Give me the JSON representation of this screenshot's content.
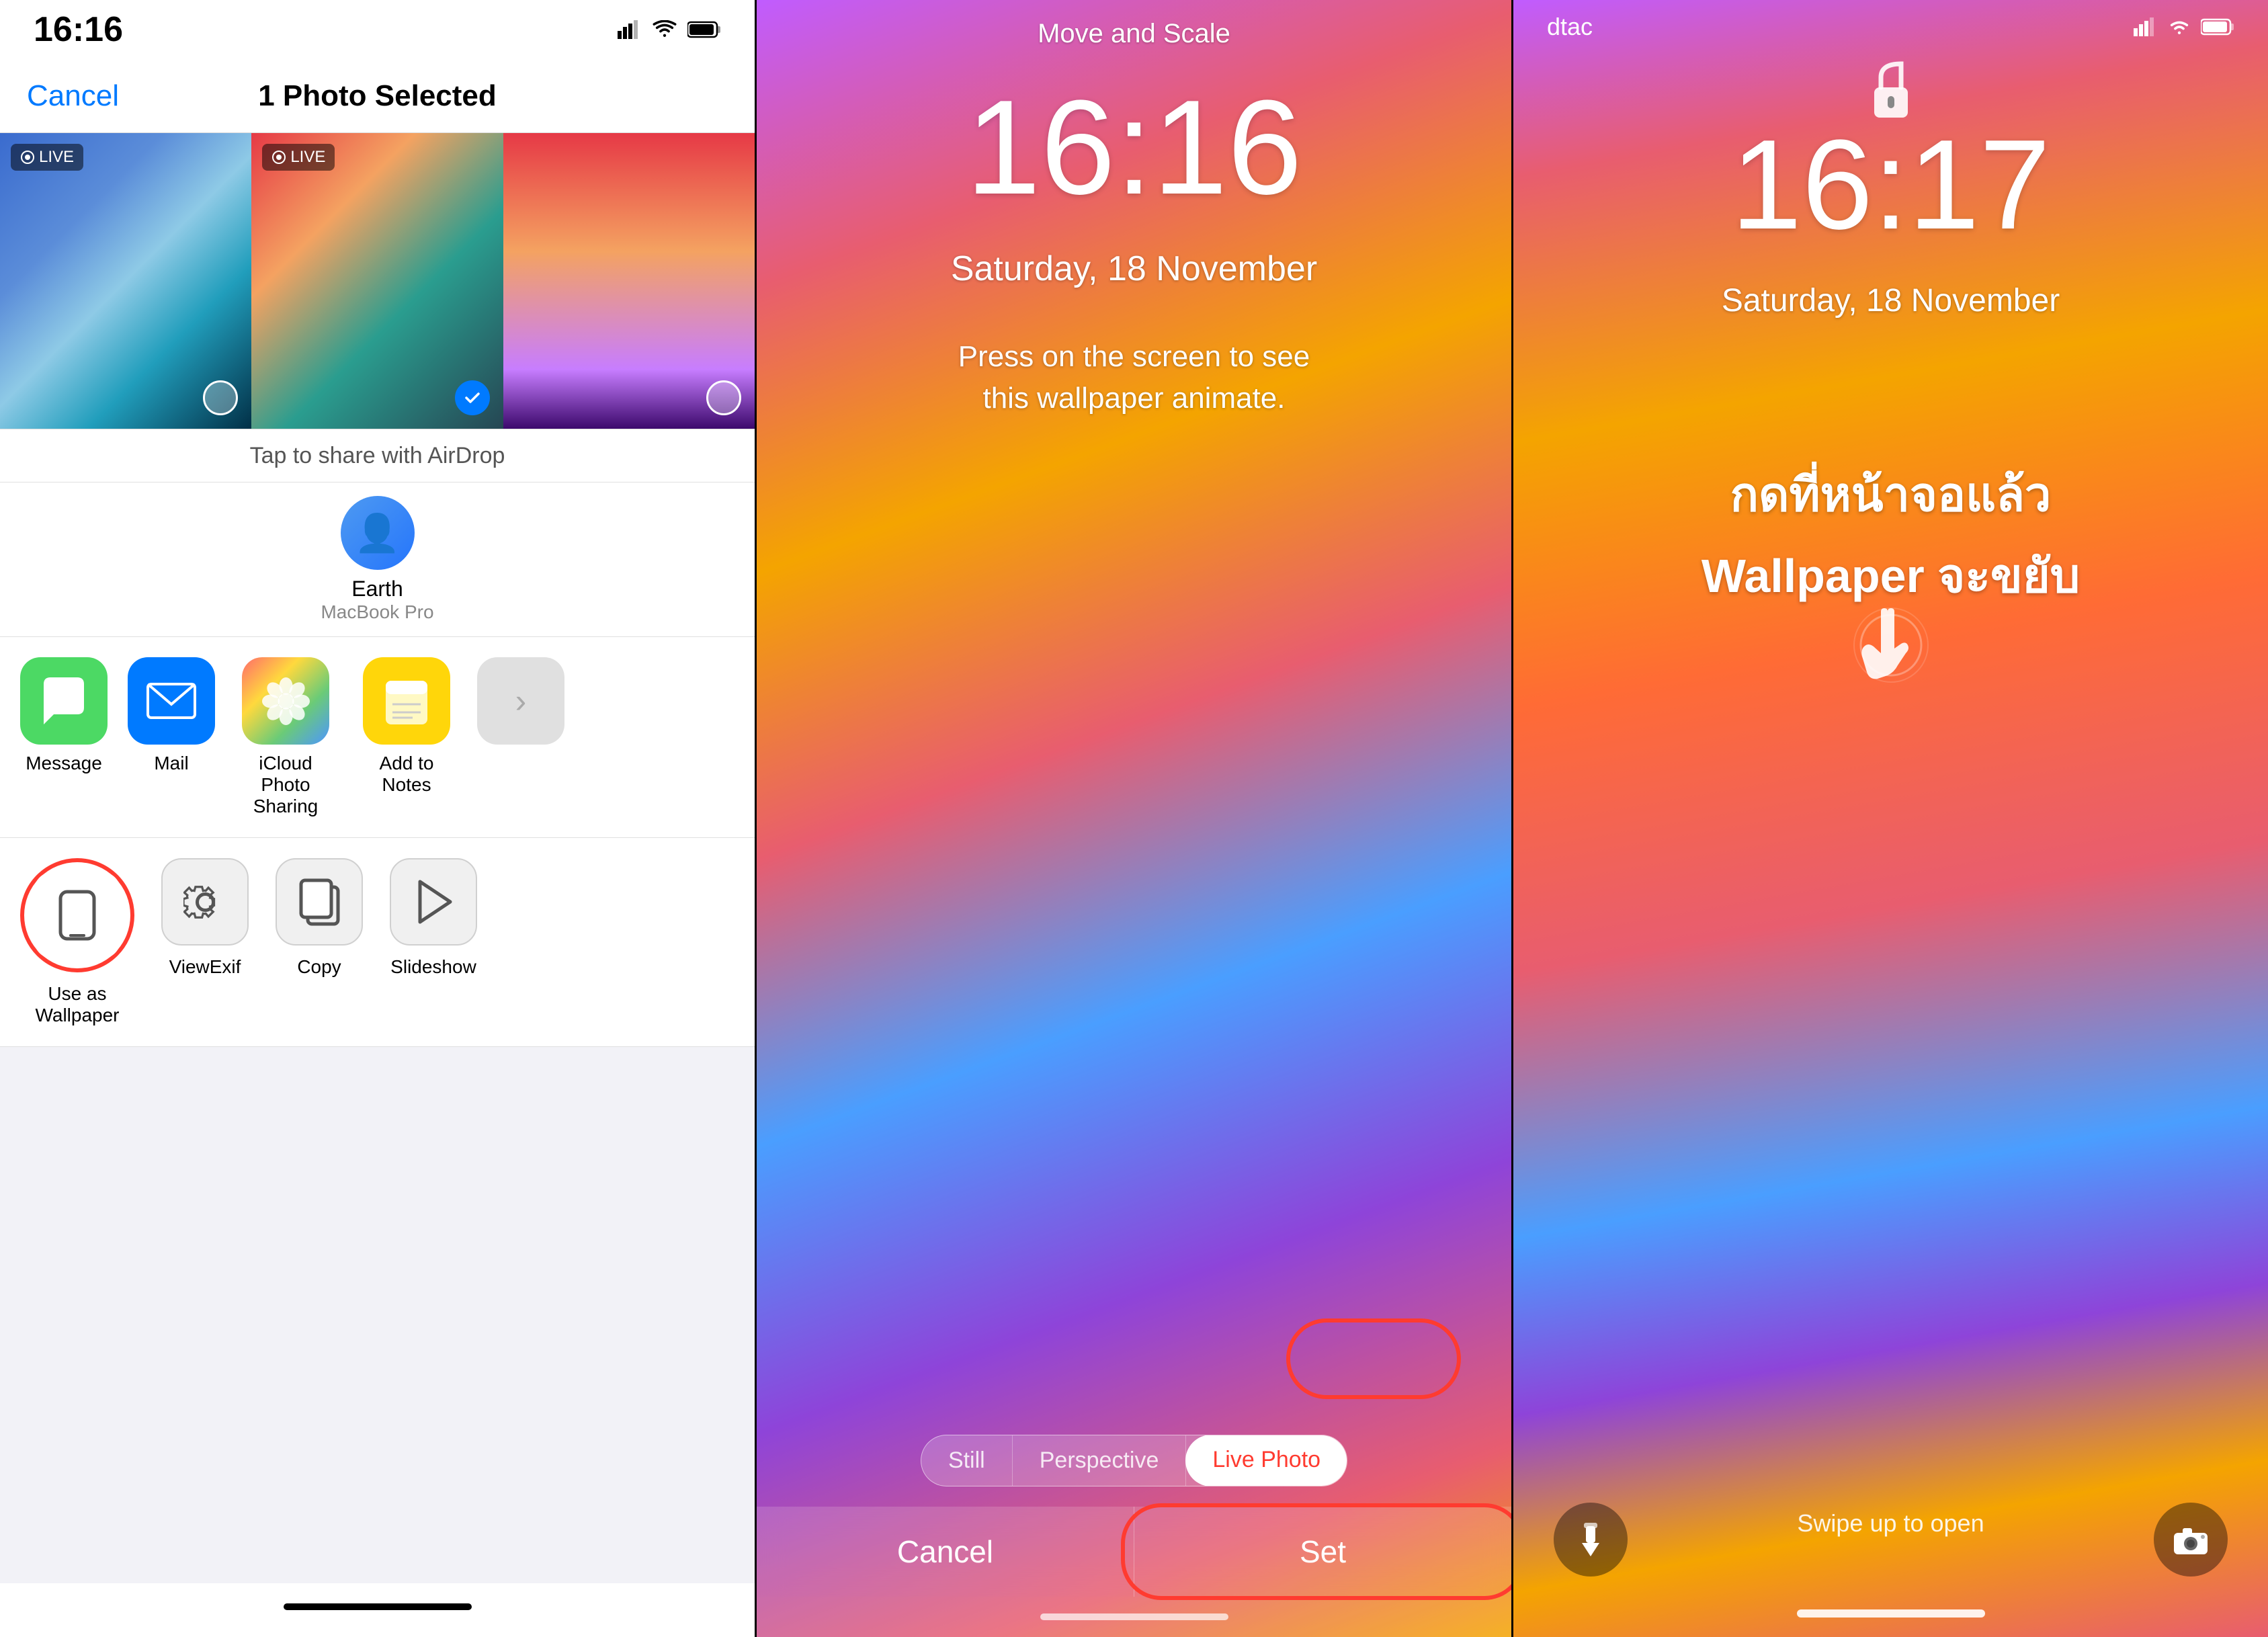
{
  "panel1": {
    "status_bar": {
      "time": "16:16",
      "signal_icon": "signal-bars",
      "wifi_icon": "wifi",
      "battery_icon": "battery"
    },
    "nav": {
      "cancel_label": "Cancel",
      "title": "1 Photo Selected"
    },
    "photos": [
      {
        "live": true,
        "selected": false,
        "bg": "1"
      },
      {
        "live": true,
        "selected": true,
        "bg": "2"
      },
      {
        "live": false,
        "selected": false,
        "bg": "3"
      }
    ],
    "airdrop_hint": "Tap to share with AirDrop",
    "device": {
      "name": "Earth",
      "type": "MacBook Pro"
    },
    "share_apps": [
      {
        "label": "Message",
        "icon_type": "message"
      },
      {
        "label": "Mail",
        "icon_type": "mail"
      },
      {
        "label": "iCloud Photo\nSharing",
        "icon_type": "photos"
      },
      {
        "label": "Add to Notes",
        "icon_type": "notes"
      }
    ],
    "actions": [
      {
        "label": "Use as\nWallpaper",
        "icon": "phone"
      },
      {
        "label": "ViewExif",
        "icon": "gear"
      },
      {
        "label": "Copy",
        "icon": "copy"
      },
      {
        "label": "Slideshow",
        "icon": "play"
      }
    ]
  },
  "panel2": {
    "header_title": "Move and Scale",
    "time": "16:16",
    "date": "Saturday, 18 November",
    "hint": "Press on the screen to see\nthis wallpaper animate.",
    "type_options": [
      {
        "label": "Still",
        "active": false
      },
      {
        "label": "Perspective",
        "active": false
      },
      {
        "label": "Live Photo",
        "active": true
      }
    ],
    "cancel_label": "Cancel",
    "set_label": "Set"
  },
  "panel3": {
    "carrier": "dtac",
    "time": "16:17",
    "date": "Saturday, 18 November",
    "thai_text_line1": "กดที่หน้าจอแล้ว",
    "thai_text_line2": "Wallpaper จะขยับ",
    "swipe_hint": "Swipe up to open",
    "torch_icon": "torch",
    "camera_icon": "camera"
  }
}
